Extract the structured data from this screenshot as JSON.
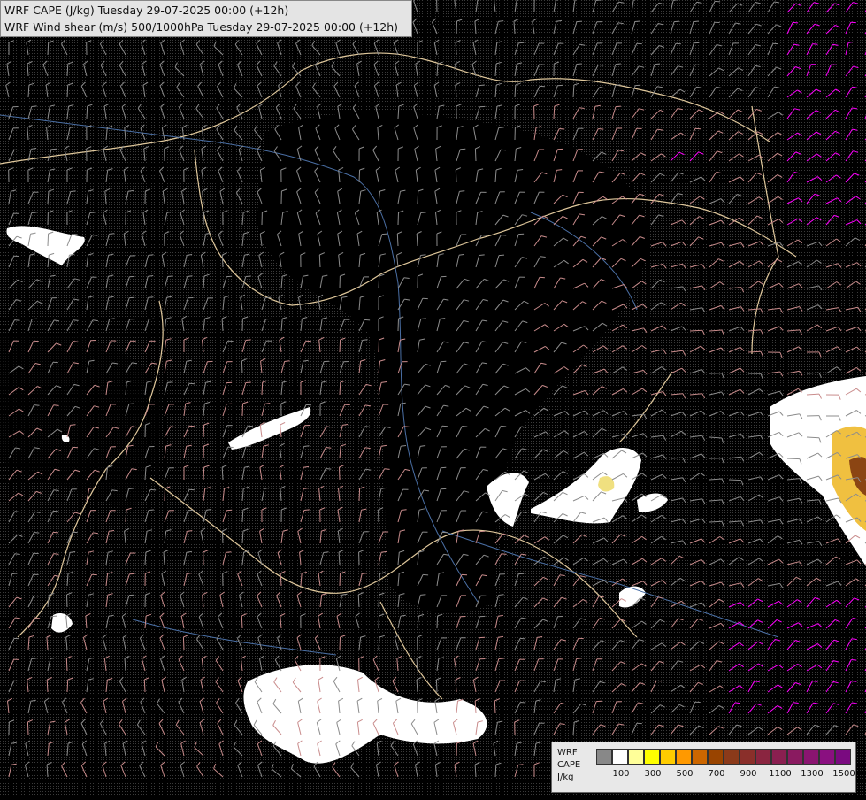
{
  "title": {
    "line1": "WRF CAPE (J/kg) Tuesday 29-07-2025 00:00 (+12h)",
    "line2": "WRF Wind shear (m/s) 500/1000hPa Tuesday 29-07-2025 00:00 (+12h)"
  },
  "legend": {
    "label_line1": "WRF",
    "label_line2": "CAPE",
    "label_line3": "J/kg",
    "colors": [
      "#888888",
      "#ffffff",
      "#ffff99",
      "#ffff00",
      "#ffcc00",
      "#ff9900",
      "#cc6600",
      "#994400",
      "#8b3a1a",
      "#8a2f2a",
      "#8a2540",
      "#8a1f50",
      "#8a1a60",
      "#8a1570",
      "#8a1080",
      "#7a0a80"
    ],
    "ticks": [
      "100",
      "300",
      "500",
      "700",
      "900",
      "1100",
      "1300",
      "1500"
    ]
  },
  "colors": {
    "background": "#000000",
    "wind_low": "#8c8c8c",
    "wind_mid": "#c98c8c",
    "wind_high": "#ff00ff",
    "border": "#e0c89c",
    "river": "#4a6fa5",
    "cape_low": "#ffffff",
    "cape_high": "#ffdd33"
  }
}
